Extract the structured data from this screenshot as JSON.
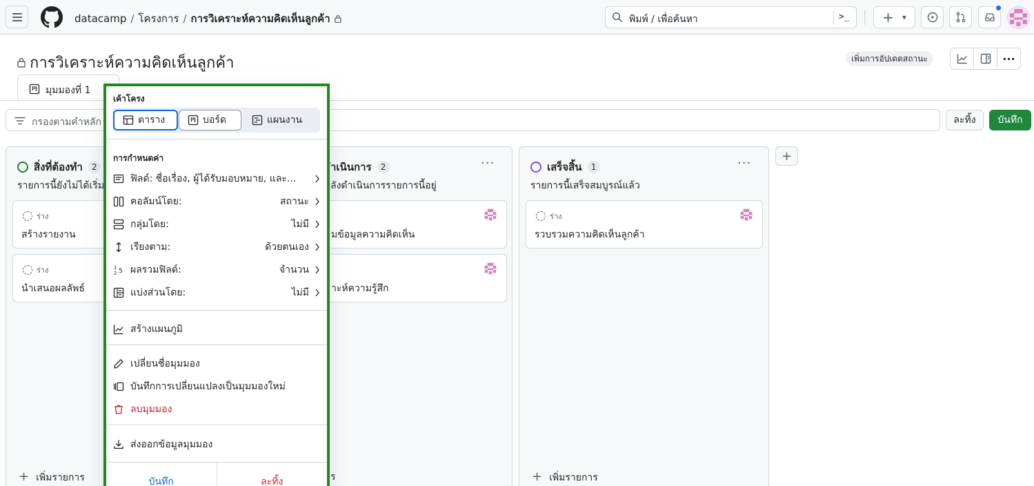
{
  "header": {
    "breadcrumb": {
      "org": "datacamp",
      "section": "โครงการ",
      "project": "การวิเคราะห์ความคิดเห็นลูกค้า",
      "sep": "/"
    },
    "search": {
      "placeholder": "พิมพ์ / เพื่อค้นหา",
      "terminal_glyph": ">_"
    },
    "buttons": {
      "plus": "+",
      "caret": "▾"
    },
    "has_notification": true
  },
  "project": {
    "title": "การวิเคราะห์ความคิดเห็นลูกค้า",
    "status_update_label": "เพิ่มการอัปเดตสถานะ",
    "more": "···",
    "view_tab": "มุมมองที่ 1"
  },
  "filter": {
    "placeholder": "กรองตามคำหลัก",
    "discard_label": "ละทิ้ง",
    "save_label": "บันทึก"
  },
  "board": {
    "add_item_label": "เพิ่มรายการ",
    "add_column_glyph": "+",
    "columns": [
      {
        "name": "สิ่งที่ต้องทำ",
        "count": "2",
        "description": "รายการนี้ยังไม่ได้เริ่ม",
        "status_color": "#1a7f37",
        "cards": [
          {
            "draft_label": "ร่าง",
            "title": "สร้างรายงาน"
          },
          {
            "draft_label": "ร่าง",
            "title": "นำเสนอผลลัพธ์"
          }
        ]
      },
      {
        "name": "กำลังดำเนินการ",
        "name_visible": "ำเนินการ",
        "count": "2",
        "description": "กำลังดำเนินการรายการนี้อยู่",
        "description_visible": "ลังดำเนินการรายการนี้อยู่",
        "status_color": "#9a6700",
        "cards": [
          {
            "title": "รวบรวมข้อมูลความคิดเห็น",
            "title_visible": "มข้อมูลความคิดเห็น"
          },
          {
            "title": "วิเคราะห์ความรู้สึก",
            "title_visible": "าะห์ความรู้สึก"
          }
        ],
        "add_item_visible": "ร"
      },
      {
        "name": "เสร็จสิ้น",
        "count": "1",
        "description": "รายการนี้เสร็จสมบูรณ์แล้ว",
        "status_color": "#8250df",
        "cards": [
          {
            "draft_label": "ร่าง",
            "title": "รวบรวมความคิดเห็นลูกค้า"
          }
        ]
      }
    ]
  },
  "menu": {
    "layout_title": "เค้าโครง",
    "layouts": [
      {
        "label": "ตาราง",
        "icon": "table-icon",
        "state": "active"
      },
      {
        "label": "บอร์ด",
        "icon": "board-icon",
        "state": "outlined"
      },
      {
        "label": "แผนงาน",
        "icon": "roadmap-icon",
        "state": "normal"
      }
    ],
    "config_title": "การกำหนดค่า",
    "config_rows": [
      {
        "label": "ฟิลด์: ชื่อเรื่อง, ผู้ได้รับมอบหมาย, และ...",
        "value": "",
        "icon": "fields-icon"
      },
      {
        "label": "คอลัมน์โดย:",
        "value": "สถานะ",
        "icon": "columns-icon"
      },
      {
        "label": "กลุ่มโดย:",
        "value": "ไม่มี",
        "icon": "rows-icon"
      },
      {
        "label": "เรียงตาม:",
        "value": "ด้วยตนเอง",
        "icon": "sort-icon"
      },
      {
        "label": "ผลรวมฟิลด์:",
        "value": "จำนวน",
        "icon": "sum-icon"
      },
      {
        "label": "แบ่งส่วนโดย:",
        "value": "ไม่มี",
        "icon": "slice-icon"
      }
    ],
    "create_chart": "สร้างแผนภูมิ",
    "rename_view": "เปลี่ยนชื่อมุมมอง",
    "save_as_new": "บันทึกการเปลี่ยนแปลงเป็นมุมมองใหม่",
    "delete_view": "ลบมุมมอง",
    "export_view": "ส่งออกข้อมูลมุมมอง",
    "footer_save": "บันทึก",
    "footer_discard": "ละทิ้ง",
    "accent_border": "#1e8a1e"
  }
}
